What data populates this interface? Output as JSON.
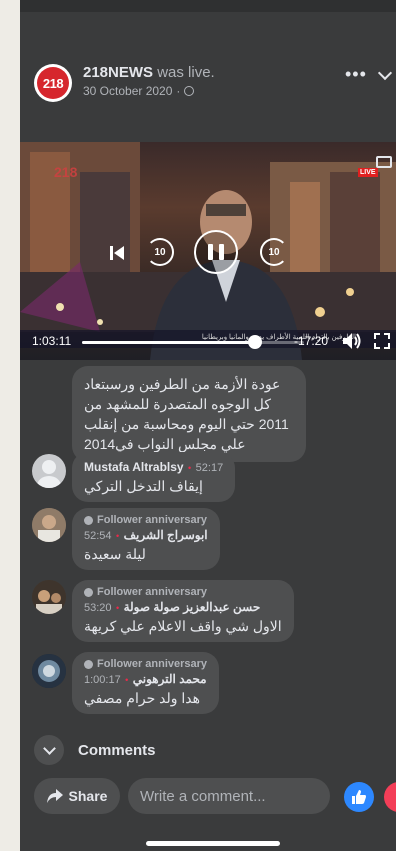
{
  "post": {
    "page_name": "218NEWS",
    "status": "was live.",
    "date": "30 October 2020",
    "separator": "·",
    "more_label": "•••",
    "logo_text": "218"
  },
  "video": {
    "elapsed": "1:03:11",
    "remaining": "-17:20",
    "progress": 0.78,
    "live_label": "LIVE",
    "rewind_label": "10",
    "forward_label": "10",
    "ticker": "الطرفين بالتزام الليبية الأطراف يدعو والمانيا وبريطانيا"
  },
  "comments": [
    {
      "type": "text-only",
      "text_lines": [
        "عودة الأزمة من الطرفين ورسبتعاد",
        "كل الوجوه المتصدرة للمشهد من",
        "2011 حتي اليوم ومحاسبة من إنقلب",
        "علي مجلس النواب في2014"
      ]
    },
    {
      "author": "Mustafa Altrablsy",
      "time": "52:17",
      "text": "إيقاف التدخل التركي",
      "avatar": "default-avatar"
    },
    {
      "badge": "Follower anniversary",
      "author": "ابوسراج الشريف",
      "time": "52:54",
      "text": "ليلة سعيدة",
      "avatar": "photo-avatar"
    },
    {
      "badge": "Follower anniversary",
      "author": "حسن عبدالعزيز صولة صولة",
      "time": "53:20",
      "text": "الاول شي واقف الاعلام علي كريهة",
      "avatar": "photo-avatar"
    },
    {
      "badge": "Follower anniversary",
      "author": "محمد الترهوني",
      "time": "1:00:17",
      "text": "هدا ولد حرام مصفي",
      "avatar": "photo-avatar"
    }
  ],
  "collapse": {
    "label": "Comments"
  },
  "actions": {
    "share_label": "Share",
    "comment_placeholder": "Write a comment...",
    "like_icon": "thumbs-up-icon",
    "love_icon": "heart-icon"
  },
  "colors": {
    "background": "#3a3b3c",
    "bubble": "#4e4f50",
    "like": "#2d88ff",
    "love": "#f33e58",
    "live_dot": "#f02849",
    "logo_red": "#d6262d"
  }
}
